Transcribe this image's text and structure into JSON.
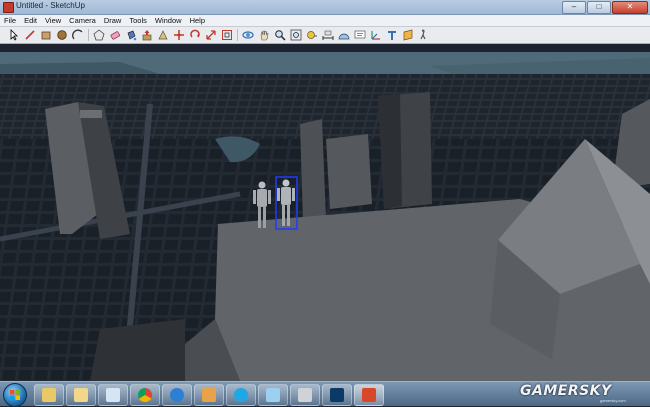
{
  "window": {
    "title": "Untitled - SketchUp",
    "buttons": [
      "–",
      "□",
      "✕"
    ]
  },
  "menu": {
    "items": [
      {
        "label": "File"
      },
      {
        "label": "Edit"
      },
      {
        "label": "View"
      },
      {
        "label": "Camera"
      },
      {
        "label": "Draw"
      },
      {
        "label": "Tools"
      },
      {
        "label": "Window"
      },
      {
        "label": "Help"
      }
    ]
  },
  "toolbar": {
    "tools": [
      "select-icon",
      "line-icon",
      "rectangle-icon",
      "circle-icon",
      "arc-icon",
      "polygon-icon",
      "eraser-icon",
      "paint-bucket-icon",
      "push-pull-icon",
      "follow-me-icon",
      "move-icon",
      "rotate-icon",
      "scale-icon",
      "offset-icon",
      "orbit-icon",
      "pan-icon",
      "zoom-icon",
      "zoom-extents-icon",
      "tape-measure-icon",
      "dimension-icon",
      "protractor-icon",
      "text-icon",
      "axes-icon",
      "3d-text-icon",
      "section-plane-icon",
      "walk-icon",
      "look-around-icon",
      "position-camera-icon",
      "warehouse-icon",
      "components-icon"
    ],
    "accent": "#2f6db5"
  },
  "taskbar": {
    "apps": [
      "explorer-icon",
      "library-icon",
      "media-icon",
      "chrome-icon",
      "ie-icon",
      "folder-icon",
      "skype-icon",
      "paint-icon",
      "sketchup-figure-icon",
      "photoshop-icon",
      "sketchup-icon"
    ]
  },
  "watermark": {
    "text": "GAMERSKY",
    "sub": "gamersky.com"
  },
  "scene": {
    "selected_figure_color": "#1e3cff"
  }
}
